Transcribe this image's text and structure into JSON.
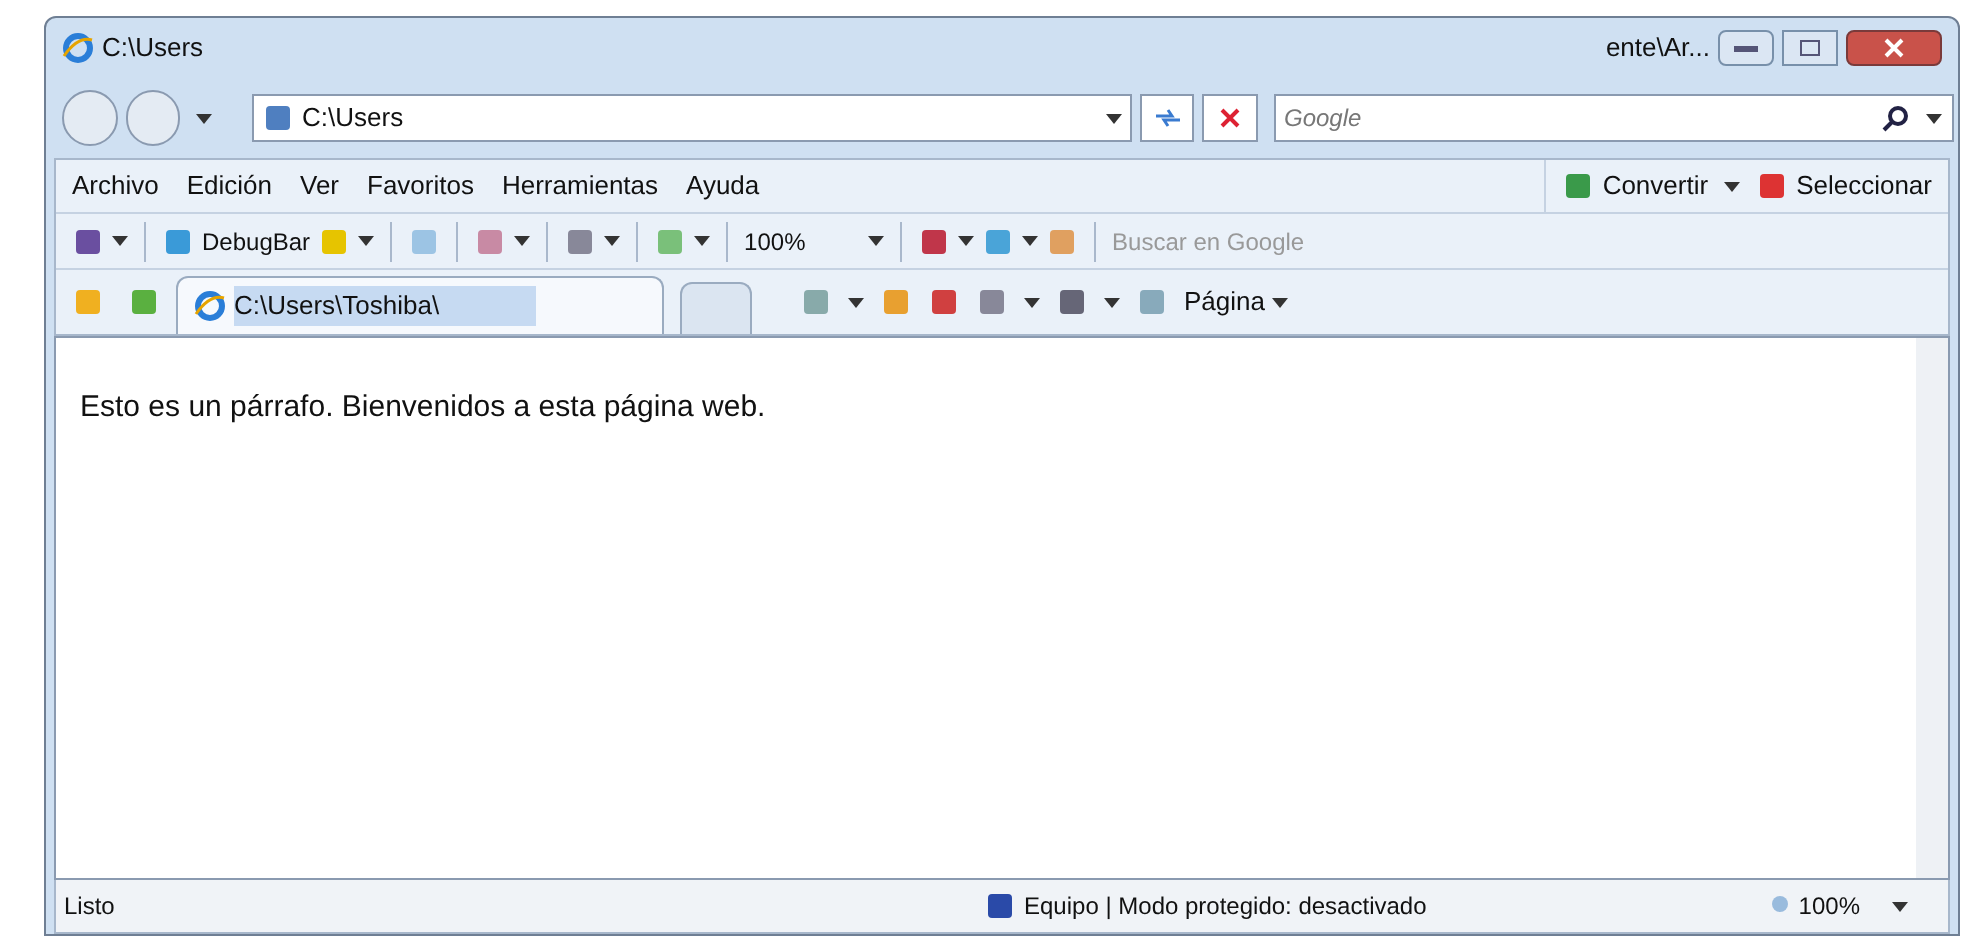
{
  "window": {
    "title": "C:\\Users",
    "title_right": "ente\\Ar..."
  },
  "address_bar": {
    "value": "C:\\Users"
  },
  "search": {
    "placeholder": "Google"
  },
  "menu": [
    "Archivo",
    "Edición",
    "Ver",
    "Favoritos",
    "Herramientas",
    "Ayuda"
  ],
  "menu_right": [
    "Convertir",
    "Seleccionar"
  ],
  "toolbar": {
    "debugbar": "DebugBar",
    "zoom": "100%",
    "search_placeholder": "Buscar en Google"
  },
  "tabs": [
    {
      "label": "C:\\Users\\Toshiba\\",
      "selected": true
    }
  ],
  "command_bar": {
    "page": "Página"
  },
  "content": {
    "paragraph": "Esto es un párrafo. Bienvenidos a esta página web."
  },
  "status_bar": {
    "status": "Listo",
    "zone": "Equipo | Modo protegido: desactivado",
    "zoom": "100%"
  }
}
